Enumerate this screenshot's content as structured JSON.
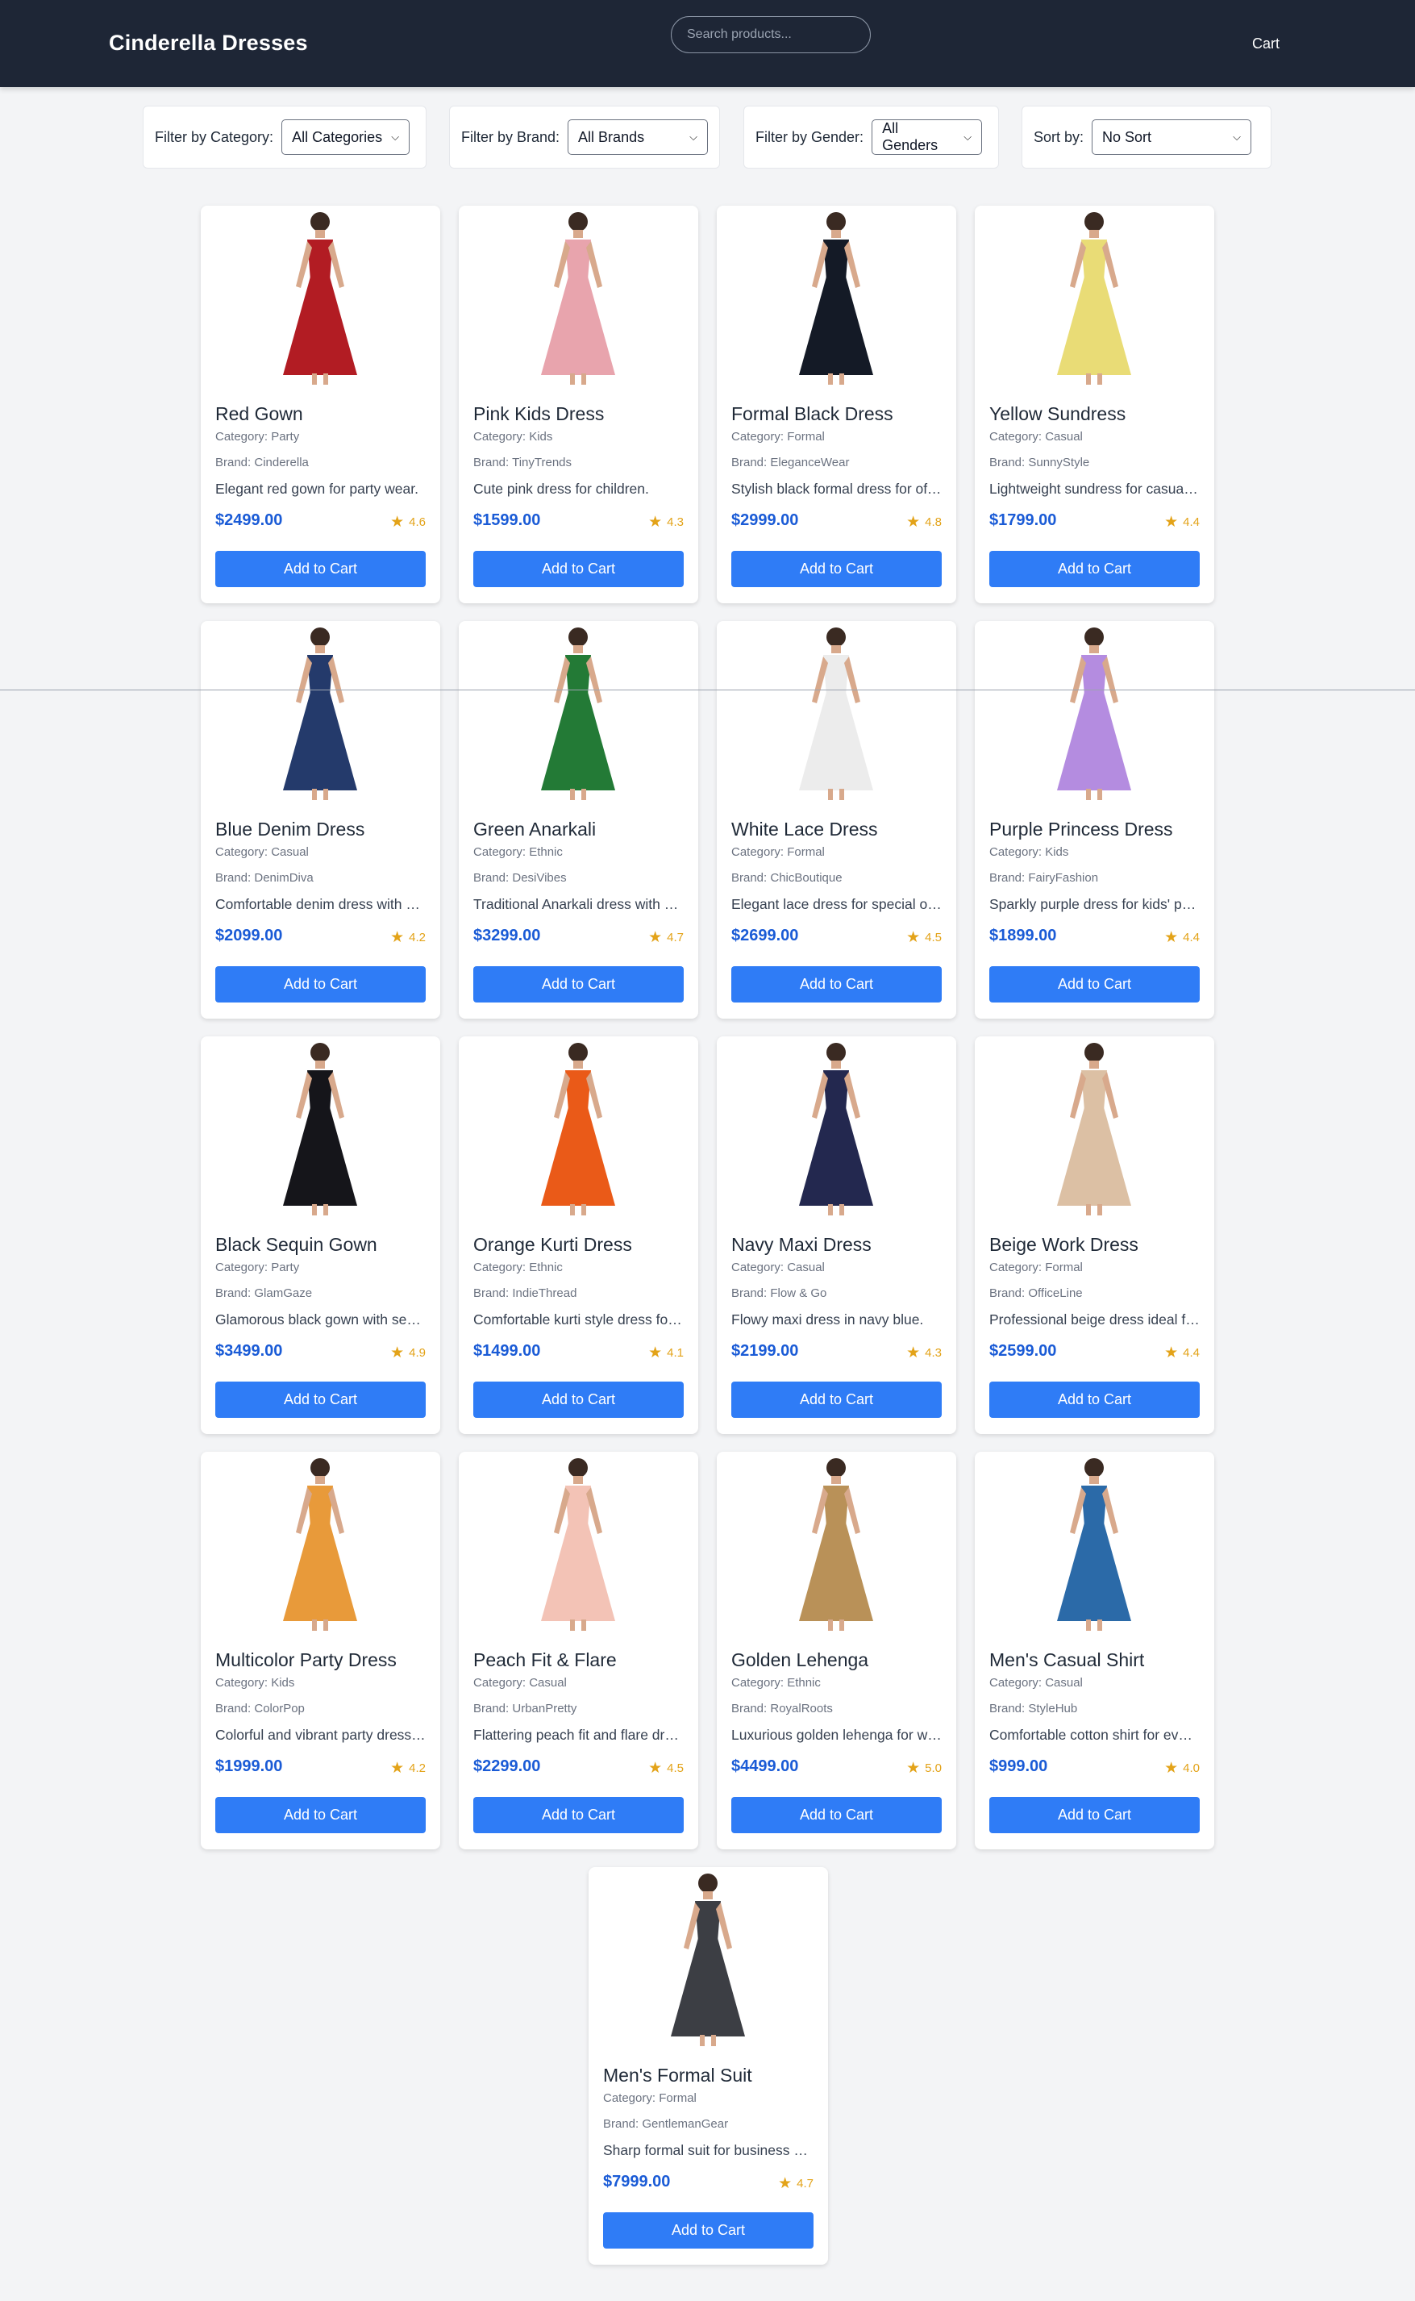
{
  "header": {
    "brand": "Cinderella Dresses",
    "search_placeholder": "Search products...",
    "cart_label": "Cart"
  },
  "filters": [
    {
      "label": "Filter by Category:",
      "value": "All Categories"
    },
    {
      "label": "Filter by Brand:",
      "value": "All Brands"
    },
    {
      "label": "Filter by Gender:",
      "value": "All Genders"
    },
    {
      "label": "Sort by:",
      "value": "No Sort"
    }
  ],
  "add_to_cart_label": "Add to Cart",
  "products": [
    {
      "name": "Red Gown",
      "category": "Category: Party",
      "brand": "Brand: Cinderella",
      "description": "Elegant red gown for party wear.",
      "price": "$2499.00",
      "rating": "4.6",
      "image": "red-gown-image",
      "color": "#b21c23"
    },
    {
      "name": "Pink Kids Dress",
      "category": "Category: Kids",
      "brand": "Brand: TinyTrends",
      "description": "Cute pink dress for children.",
      "price": "$1599.00",
      "rating": "4.3",
      "image": "pink-kids-dress-image",
      "color": "#e8a4ad"
    },
    {
      "name": "Formal Black Dress",
      "category": "Category: Formal",
      "brand": "Brand: EleganceWear",
      "description": "Stylish black formal dress for office wear.",
      "price": "$2999.00",
      "rating": "4.8",
      "image": "formal-black-dress-image",
      "color": "#141a26"
    },
    {
      "name": "Yellow Sundress",
      "category": "Category: Casual",
      "brand": "Brand: SunnyStyle",
      "description": "Lightweight sundress for casual summer days.",
      "price": "$1799.00",
      "rating": "4.4",
      "image": "yellow-sundress-image",
      "color": "#e9dc76"
    },
    {
      "name": "Blue Denim Dress",
      "category": "Category: Casual",
      "brand": "Brand: DenimDiva",
      "description": "Comfortable denim dress with a modern fit.",
      "price": "$2099.00",
      "rating": "4.2",
      "image": "blue-denim-dress-image",
      "color": "#243a6b"
    },
    {
      "name": "Green Anarkali",
      "category": "Category: Ethnic",
      "brand": "Brand: DesiVibes",
      "description": "Traditional Anarkali dress with embroidery.",
      "price": "$3299.00",
      "rating": "4.7",
      "image": "green-anarkali-image",
      "color": "#237a36"
    },
    {
      "name": "White Lace Dress",
      "category": "Category: Formal",
      "brand": "Brand: ChicBoutique",
      "description": "Elegant lace dress for special occasions.",
      "price": "$2699.00",
      "rating": "4.5",
      "image": "white-lace-dress-image",
      "color": "#ececec"
    },
    {
      "name": "Purple Princess Dress",
      "category": "Category: Kids",
      "brand": "Brand: FairyFashion",
      "description": "Sparkly purple dress for kids' parties.",
      "price": "$1899.00",
      "rating": "4.4",
      "image": "purple-princess-dress-image",
      "color": "#b48ce0"
    },
    {
      "name": "Black Sequin Gown",
      "category": "Category: Party",
      "brand": "Brand: GlamGaze",
      "description": "Glamorous black gown with sequins.",
      "price": "$3499.00",
      "rating": "4.9",
      "image": "black-sequin-gown-image",
      "color": "#15151a"
    },
    {
      "name": "Orange Kurti Dress",
      "category": "Category: Ethnic",
      "brand": "Brand: IndieThread",
      "description": "Comfortable kurti style dress for festivals.",
      "price": "$1499.00",
      "rating": "4.1",
      "image": "orange-kurti-dress-image",
      "color": "#ea5a18"
    },
    {
      "name": "Navy Maxi Dress",
      "category": "Category: Casual",
      "brand": "Brand: Flow & Go",
      "description": "Flowy maxi dress in navy blue.",
      "price": "$2199.00",
      "rating": "4.3",
      "image": "navy-maxi-dress-image",
      "color": "#23284f"
    },
    {
      "name": "Beige Work Dress",
      "category": "Category: Formal",
      "brand": "Brand: OfficeLine",
      "description": "Professional beige dress ideal for work.",
      "price": "$2599.00",
      "rating": "4.4",
      "image": "beige-work-dress-image",
      "color": "#dcc0a4"
    },
    {
      "name": "Multicolor Party Dress",
      "category": "Category: Kids",
      "brand": "Brand: ColorPop",
      "description": "Colorful and vibrant party dress for kids.",
      "price": "$1999.00",
      "rating": "4.2",
      "image": "multicolor-party-dress-image",
      "color": "#e89a3a"
    },
    {
      "name": "Peach Fit & Flare",
      "category": "Category: Casual",
      "brand": "Brand: UrbanPretty",
      "description": "Flattering peach fit and flare dress.",
      "price": "$2299.00",
      "rating": "4.5",
      "image": "peach-fit-flare-image",
      "color": "#f3c3b6"
    },
    {
      "name": "Golden Lehenga",
      "category": "Category: Ethnic",
      "brand": "Brand: RoyalRoots",
      "description": "Luxurious golden lehenga for weddings.",
      "price": "$4499.00",
      "rating": "5.0",
      "image": "golden-lehenga-image",
      "color": "#b99158"
    },
    {
      "name": "Men's Casual Shirt",
      "category": "Category: Casual",
      "brand": "Brand: StyleHub",
      "description": "Comfortable cotton shirt for everyday wear.",
      "price": "$999.00",
      "rating": "4.0",
      "image": "mens-casual-shirt-image",
      "color": "#2b6aa8"
    },
    {
      "name": "Men's Formal Suit",
      "category": "Category: Formal",
      "brand": "Brand: GentlemanGear",
      "description": "Sharp formal suit for business meetings.",
      "price": "$7999.00",
      "rating": "4.7",
      "image": "mens-formal-suit-image",
      "color": "#3c3e44"
    }
  ]
}
